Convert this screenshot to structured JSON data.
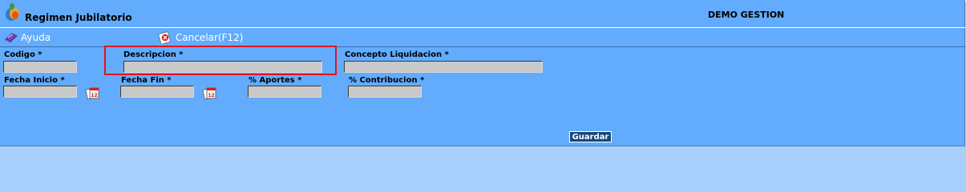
{
  "header": {
    "title": "Regimen Jubilatorio",
    "company": "DEMO GESTION"
  },
  "toolbar": {
    "help_label": "Ayuda",
    "cancel_label": "Cancelar(F12)"
  },
  "form": {
    "codigo": {
      "label": "Codigo *",
      "value": ""
    },
    "descripcion": {
      "label": "Descripcion *",
      "value": ""
    },
    "concepto": {
      "label": "Concepto Liquidacion *",
      "value": ""
    },
    "fecha_inicio": {
      "label": "Fecha Inicio *",
      "value": ""
    },
    "fecha_fin": {
      "label": "Fecha Fin *",
      "value": ""
    },
    "aportes": {
      "label": "% Aportes *",
      "value": ""
    },
    "contribucion": {
      "label": "% Contribucion *",
      "value": ""
    },
    "calendar_badge": "12"
  },
  "actions": {
    "save_label": "Guardar"
  },
  "colors": {
    "background": "#63acfd",
    "outer": "#a8d0fc",
    "highlight": "#e0141e",
    "button": "#16477a"
  }
}
